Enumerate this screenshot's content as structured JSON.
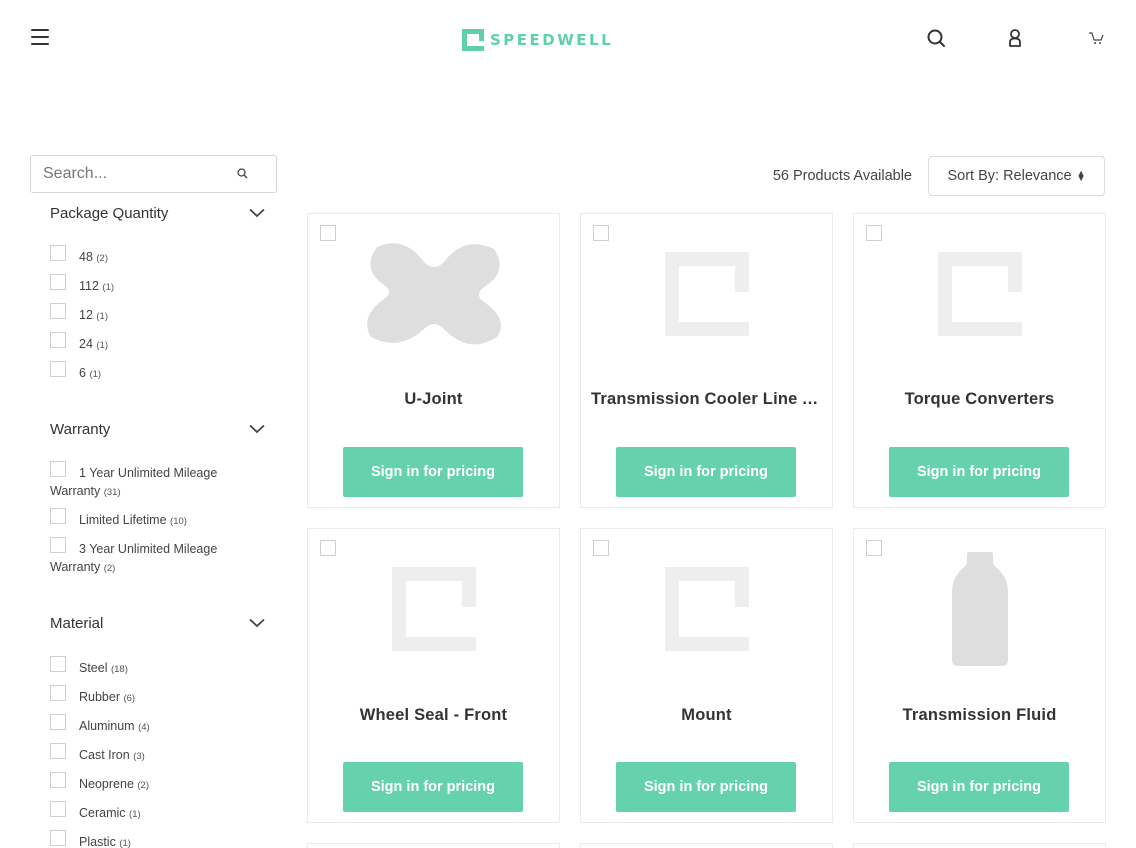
{
  "brand": {
    "name": "SPEEDWELL",
    "accent": "#5fd0aa",
    "button_color": "#65d2ad"
  },
  "header": {
    "menu_icon": "hamburger-icon",
    "search_icon": "search-icon",
    "account_icon": "user-icon",
    "cart_icon": "cart-icon"
  },
  "search": {
    "placeholder": "Search...",
    "value": ""
  },
  "facets": {
    "package_quantity": {
      "title": "Package Quantity",
      "options": [
        {
          "label": "48",
          "count": "(2)"
        },
        {
          "label": "112",
          "count": "(1)"
        },
        {
          "label": "12",
          "count": "(1)"
        },
        {
          "label": "24",
          "count": "(1)"
        },
        {
          "label": "6",
          "count": "(1)"
        }
      ]
    },
    "warranty": {
      "title": "Warranty",
      "options": [
        {
          "label": "1 Year Unlimited Mileage Warranty",
          "count": "(31)"
        },
        {
          "label": "Limited Lifetime",
          "count": "(10)"
        },
        {
          "label": "3 Year Unlimited Mileage Warranty",
          "count": "(2)"
        }
      ]
    },
    "material": {
      "title": "Material",
      "options": [
        {
          "label": "Steel",
          "count": "(18)"
        },
        {
          "label": "Rubber",
          "count": "(6)"
        },
        {
          "label": "Aluminum",
          "count": "(4)"
        },
        {
          "label": "Cast Iron",
          "count": "(3)"
        },
        {
          "label": "Neoprene",
          "count": "(2)"
        },
        {
          "label": "Ceramic",
          "count": "(1)"
        },
        {
          "label": "Plastic",
          "count": "(1)"
        }
      ]
    }
  },
  "results": {
    "count_text": "56 Products Available",
    "sort_label": "Sort By: Relevance"
  },
  "products": [
    {
      "name": "U-Joint",
      "image": "u-joint-image",
      "cta": "Sign in for pricing"
    },
    {
      "name": "Transmission Cooler Line As...",
      "image": "placeholder-logo-image",
      "cta": "Sign in for pricing"
    },
    {
      "name": "Torque Converters",
      "image": "placeholder-logo-image",
      "cta": "Sign in for pricing"
    },
    {
      "name": "Wheel Seal - Front",
      "image": "placeholder-logo-image",
      "cta": "Sign in for pricing"
    },
    {
      "name": "Mount",
      "image": "placeholder-logo-image",
      "cta": "Sign in for pricing"
    },
    {
      "name": "Transmission Fluid",
      "image": "bottle-image",
      "cta": "Sign in for pricing"
    }
  ]
}
